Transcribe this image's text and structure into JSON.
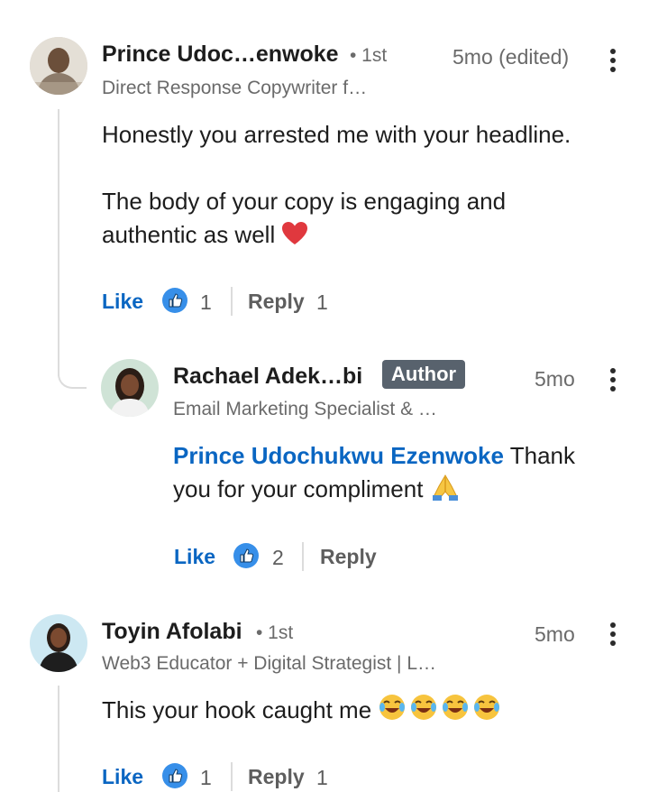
{
  "comments": [
    {
      "name": "Prince Udoc…enwoke",
      "degree": "• 1st",
      "headline": "Direct Response Copywriter f…",
      "time": "5mo (edited)",
      "text_p1": "Honestly you arrested me with your headline.",
      "text_p2": "The body of your copy is engaging and authentic as well",
      "like_label": "Like",
      "like_count": "1",
      "reply_label": "Reply",
      "reply_count": "1"
    },
    {
      "name": "Rachael Adek…bi",
      "badge": "Author",
      "headline": "Email Marketing Specialist & …",
      "time": "5mo",
      "mention": "Prince Udochukwu Ezenwoke",
      "text": "Thank you for your compliment",
      "like_label": "Like",
      "like_count": "2",
      "reply_label": "Reply"
    },
    {
      "name": "Toyin Afolabi",
      "degree": "• 1st",
      "headline": "Web3 Educator + Digital Strategist | L…",
      "time": "5mo",
      "text": "This your hook caught me",
      "like_label": "Like",
      "like_count": "1",
      "reply_label": "Reply",
      "reply_count": "1"
    }
  ],
  "colors": {
    "link": "#0a66c2",
    "badge_bg": "#58626d",
    "thread_line": "#dcdcdc"
  }
}
